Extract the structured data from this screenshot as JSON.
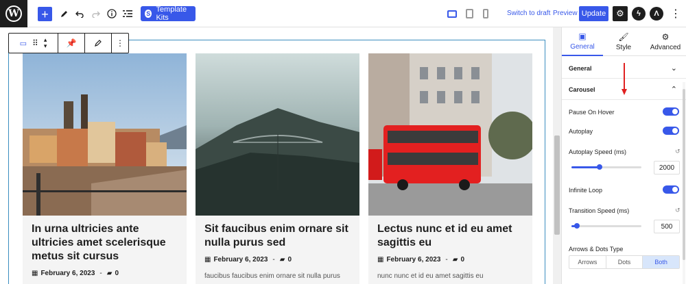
{
  "toolbar": {
    "logo_letter": "W",
    "template_kits_label": "Template Kits",
    "switch_to_draft": "Switch to draft",
    "preview": "Preview",
    "update": "Update"
  },
  "block_toolbar": {
    "items": [
      "carousel-block-icon",
      "drag-handle-icon",
      "move-up-down-icon",
      "pin-icon",
      "edit-icon",
      "more-options-icon"
    ]
  },
  "posts": [
    {
      "title": "In urna ultricies ante ultricies amet scelerisque metus sit cursus",
      "date": "February 6, 2023",
      "comments": "0",
      "excerpt": ""
    },
    {
      "title": "Sit faucibus enim ornare sit nulla purus sed",
      "date": "February 6, 2023",
      "comments": "0",
      "excerpt": "faucibus faucibus enim ornare sit nulla purus"
    },
    {
      "title": "Lectus nunc et id eu amet sagittis eu",
      "date": "February 6, 2023",
      "comments": "0",
      "excerpt": "nunc nunc et id eu amet sagittis eu"
    }
  ],
  "sidebar": {
    "tabs": [
      {
        "label": "General",
        "icon": "general-icon",
        "active": true
      },
      {
        "label": "Style",
        "icon": "style-brush-icon",
        "active": false
      },
      {
        "label": "Advanced",
        "icon": "gear-icon",
        "active": false
      }
    ],
    "sections": {
      "general": "General",
      "carousel": "Carousel"
    },
    "carousel": {
      "pause_on_hover": "Pause On Hover",
      "autoplay": "Autoplay",
      "autoplay_speed_label": "Autoplay Speed (ms)",
      "autoplay_speed_value": "2000",
      "autoplay_speed_fraction": 0.4,
      "infinite_loop": "Infinite Loop",
      "transition_speed_label": "Transition Speed (ms)",
      "transition_speed_value": "500",
      "transition_speed_fraction": 0.08,
      "arrows_dots_label": "Arrows & Dots Type",
      "arrows_dots_options": [
        "Arrows",
        "Dots",
        "Both"
      ],
      "arrows_dots_selected": "Both"
    }
  },
  "colors": {
    "accent": "#3858e9",
    "dark": "#1e1e1e",
    "annotation_arrow": "#e02020",
    "block_outline": "#3a8dbf"
  }
}
